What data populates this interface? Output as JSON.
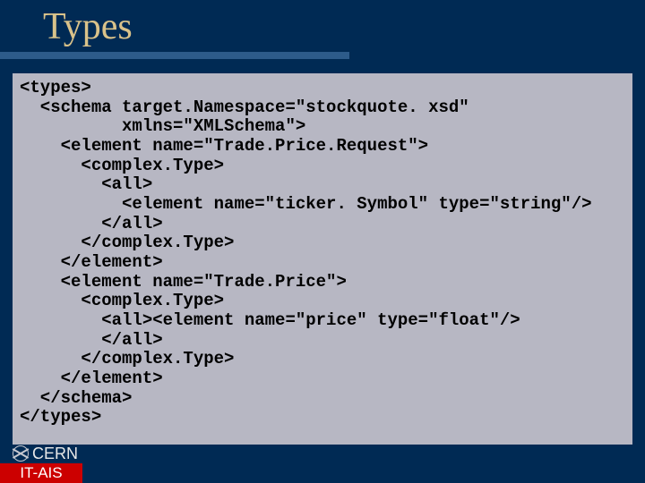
{
  "title": "Types",
  "code": "<types>\n  <schema target.Namespace=\"stockquote. xsd\"\n          xmlns=\"XMLSchema\">\n    <element name=\"Trade.Price.Request\">\n      <complex.Type>\n        <all>\n          <element name=\"ticker. Symbol\" type=\"string\"/>\n        </all>\n      </complex.Type>\n    </element>\n    <element name=\"Trade.Price\">\n      <complex.Type>\n        <all><element name=\"price\" type=\"float\"/>\n        </all>\n      </complex.Type>\n    </element>\n  </schema>\n</types>",
  "footer": {
    "org": "CERN",
    "dept": "IT-AIS"
  }
}
